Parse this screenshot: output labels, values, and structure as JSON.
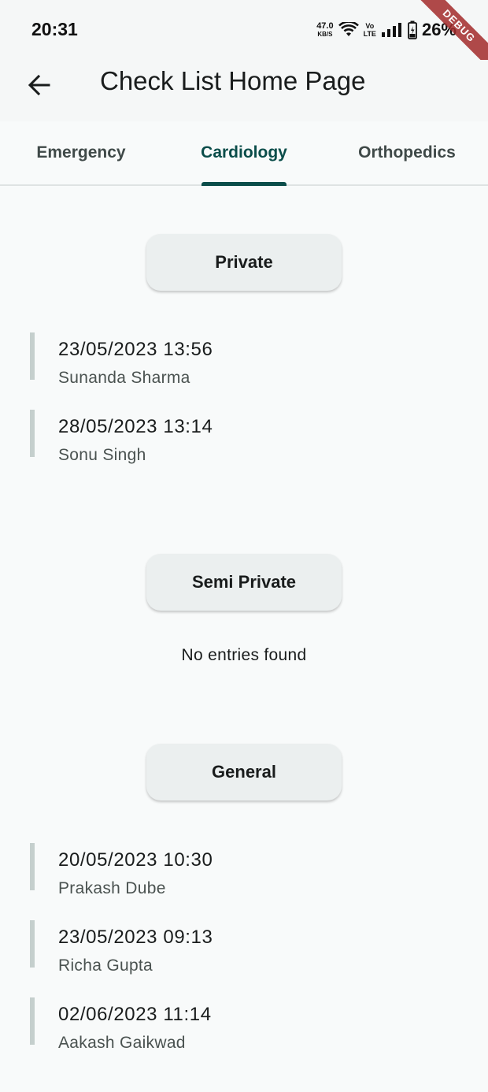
{
  "status_bar": {
    "time": "20:31",
    "net_speed": "47.0",
    "net_unit": "KB/S",
    "volte_top": "Vo",
    "volte_bottom": "LTE",
    "battery": "26%",
    "debug": "DEBUG"
  },
  "app_bar": {
    "back_icon": "arrow-back-icon",
    "title": "Check List Home Page"
  },
  "tabs": [
    {
      "label": "Emergency",
      "active": false
    },
    {
      "label": "Cardiology",
      "active": true
    },
    {
      "label": "Orthopedics",
      "active": false
    }
  ],
  "sections": [
    {
      "label": "Private",
      "entries": [
        {
          "date": "23/05/2023 13:56",
          "name": "Sunanda Sharma"
        },
        {
          "date": "28/05/2023 13:14",
          "name": "Sonu Singh"
        }
      ]
    },
    {
      "label": "Semi Private",
      "empty_text": "No entries found",
      "entries": []
    },
    {
      "label": "General",
      "entries": [
        {
          "date": "20/05/2023 10:30",
          "name": "Prakash Dube"
        },
        {
          "date": "23/05/2023 09:13",
          "name": "Richa Gupta"
        },
        {
          "date": "02/06/2023 11:14",
          "name": "Aakash Gaikwad"
        }
      ]
    }
  ],
  "colors": {
    "accent": "#0b4d4a",
    "background": "#f8fafa",
    "entry_bar": "#c5cfcd"
  }
}
